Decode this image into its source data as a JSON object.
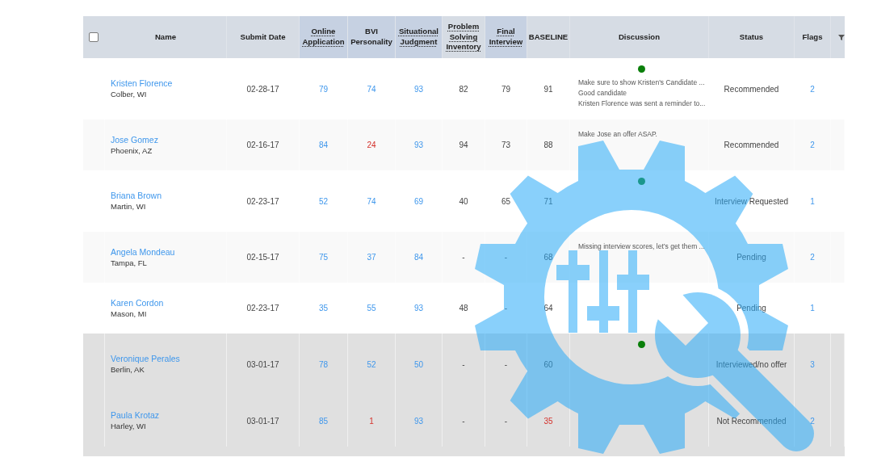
{
  "table": {
    "header": {
      "select_all": {
        "checked": false
      },
      "columns": [
        {
          "label": "Name",
          "underlined": false,
          "highlighted": false
        },
        {
          "label": "Submit Date",
          "underlined": false,
          "highlighted": false
        },
        {
          "label": "Online Application",
          "underlined": true,
          "highlighted": true
        },
        {
          "label": "BVI Personality",
          "underlined": false,
          "highlighted": true
        },
        {
          "label": "Situational Judgment",
          "underlined": true,
          "highlighted": true
        },
        {
          "label": "Problem Solving Inventory",
          "underlined": true,
          "highlighted": false
        },
        {
          "label": "Final Interview",
          "underlined": true,
          "highlighted": true
        },
        {
          "label": "BASELINE",
          "underlined": false,
          "highlighted": false
        },
        {
          "label": "Discussion",
          "underlined": false,
          "highlighted": false
        },
        {
          "label": "Status",
          "underlined": false,
          "highlighted": false
        },
        {
          "label": "Flags",
          "underlined": false,
          "highlighted": false
        }
      ]
    },
    "rows": [
      {
        "name": "Kristen Florence",
        "location": "Colber, WI",
        "submit_date": "02-28-17",
        "scores": [
          {
            "value": "79",
            "link": true,
            "low": false
          },
          {
            "value": "74",
            "link": true,
            "low": false
          },
          {
            "value": "93",
            "link": true,
            "low": false
          },
          {
            "value": "82",
            "link": false,
            "low": false
          },
          {
            "value": "79",
            "link": false,
            "low": false
          },
          {
            "value": "91",
            "link": false,
            "low": false
          }
        ],
        "discussion": {
          "indicator": true,
          "comments": [
            "Make sure to show Kristen's Candidate ...",
            "Good candidate",
            "Kristen Florence was sent a reminder to..."
          ]
        },
        "status": "Recommended",
        "flags": "2",
        "inactive": false
      },
      {
        "name": "Jose Gomez",
        "location": "Phoenix, AZ",
        "submit_date": "02-16-17",
        "scores": [
          {
            "value": "84",
            "link": true,
            "low": false
          },
          {
            "value": "24",
            "link": true,
            "low": true
          },
          {
            "value": "93",
            "link": true,
            "low": false
          },
          {
            "value": "94",
            "link": false,
            "low": false
          },
          {
            "value": "73",
            "link": false,
            "low": false
          },
          {
            "value": "88",
            "link": false,
            "low": false
          }
        ],
        "discussion": {
          "indicator": false,
          "comments": [
            "Make Jose an offer ASAP."
          ]
        },
        "status": "Recommended",
        "flags": "2",
        "inactive": false
      },
      {
        "name": "Briana Brown",
        "location": "Martin, WI",
        "submit_date": "02-23-17",
        "scores": [
          {
            "value": "52",
            "link": true,
            "low": false
          },
          {
            "value": "74",
            "link": true,
            "low": false
          },
          {
            "value": "69",
            "link": true,
            "low": false
          },
          {
            "value": "40",
            "link": false,
            "low": false
          },
          {
            "value": "65",
            "link": false,
            "low": false
          },
          {
            "value": "71",
            "link": false,
            "low": false
          }
        ],
        "discussion": {
          "indicator": true
        },
        "status": "Interview Requested",
        "flags": "1",
        "inactive": false
      },
      {
        "name": "Angela Mondeau",
        "location": "Tampa, FL",
        "submit_date": "02-15-17",
        "scores": [
          {
            "value": "75",
            "link": true,
            "low": false
          },
          {
            "value": "37",
            "link": true,
            "low": false
          },
          {
            "value": "84",
            "link": true,
            "low": false
          },
          {
            "value": "-",
            "link": false,
            "low": false
          },
          {
            "value": "-",
            "link": false,
            "low": false
          },
          {
            "value": "68",
            "link": false,
            "low": false
          }
        ],
        "discussion": {
          "indicator": false,
          "comments": [
            "Missing interview scores, let’s get them ..."
          ]
        },
        "status": "Pending",
        "flags": "2",
        "inactive": false
      },
      {
        "name": "Karen Cordon",
        "location": "Mason, MI",
        "submit_date": "02-23-17",
        "scores": [
          {
            "value": "35",
            "link": true,
            "low": false
          },
          {
            "value": "55",
            "link": true,
            "low": false
          },
          {
            "value": "93",
            "link": true,
            "low": false
          },
          {
            "value": "48",
            "link": false,
            "low": false
          },
          {
            "value": "-",
            "link": false,
            "low": false
          },
          {
            "value": "64",
            "link": false,
            "low": false
          }
        ],
        "discussion": {
          "indicator": false
        },
        "status": "Pending",
        "flags": "1",
        "inactive": false
      },
      {
        "name": "Veronique Perales",
        "location": "Berlin, AK",
        "submit_date": "03-01-17",
        "scores": [
          {
            "value": "78",
            "link": true,
            "low": false
          },
          {
            "value": "52",
            "link": true,
            "low": false
          },
          {
            "value": "50",
            "link": true,
            "low": false
          },
          {
            "value": "-",
            "link": false,
            "low": false
          },
          {
            "value": "-",
            "link": false,
            "low": false
          },
          {
            "value": "60",
            "link": false,
            "low": false
          }
        ],
        "discussion": {
          "indicator": true
        },
        "status": "Interviewed/no offer",
        "flags": "3",
        "inactive": true
      },
      {
        "name": "Paula Krotaz",
        "location": "Harley, WI",
        "submit_date": "03-01-17",
        "scores": [
          {
            "value": "85",
            "link": true,
            "low": false
          },
          {
            "value": "1",
            "link": true,
            "low": true
          },
          {
            "value": "93",
            "link": true,
            "low": false
          },
          {
            "value": "-",
            "link": false,
            "low": false
          },
          {
            "value": "-",
            "link": false,
            "low": false
          },
          {
            "value": "35",
            "link": false,
            "low": true
          }
        ],
        "discussion": {
          "indicator": false
        },
        "status": "Not Recommended",
        "flags": "2",
        "inactive": true
      }
    ]
  }
}
